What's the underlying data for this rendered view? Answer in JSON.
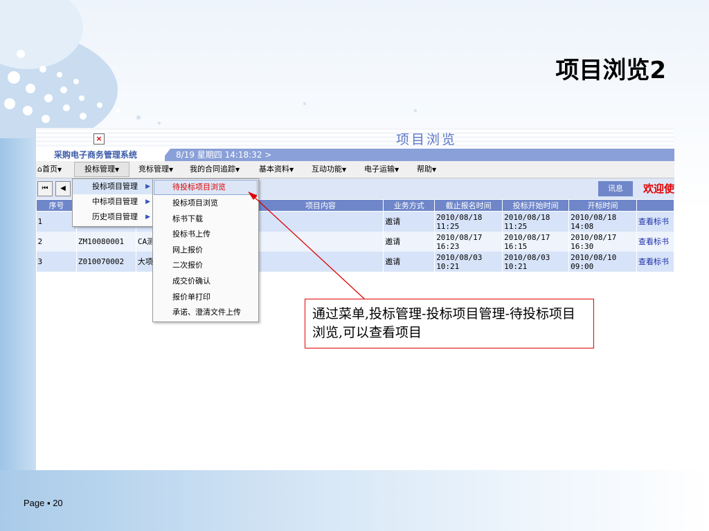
{
  "slide": {
    "title": "项目浏览2",
    "page_label": "Page ▪ 20"
  },
  "app": {
    "title": "项目浏览",
    "close_symbol": "×",
    "system_name": "采购电子商务管理系统",
    "datetime": "8/19 星期四  14:18:32 >",
    "news_label": "讯息",
    "welcome_text": "欢迎使"
  },
  "menu": [
    {
      "label": "首页",
      "icon": "home-icon"
    },
    {
      "label": "投标管理"
    },
    {
      "label": "竞标管理"
    },
    {
      "label": "我的合同追踪"
    },
    {
      "label": "基本资料"
    },
    {
      "label": "互动功能"
    },
    {
      "label": "电子运输"
    },
    {
      "label": "帮助"
    }
  ],
  "submenu": [
    {
      "label": "投标项目管理"
    },
    {
      "label": "中标项目管理"
    },
    {
      "label": "历史项目管理"
    }
  ],
  "submenu2": [
    {
      "label": "待投标项目浏览"
    },
    {
      "label": "投标项目浏览"
    },
    {
      "label": "标书下载"
    },
    {
      "label": "投标书上传"
    },
    {
      "label": "网上报价"
    },
    {
      "label": "二次报价"
    },
    {
      "label": "成交价确认"
    },
    {
      "label": "报价单打印"
    },
    {
      "label": "承诺、澄清文件上传"
    }
  ],
  "table": {
    "headers": [
      "序号",
      "",
      "",
      "项目内容",
      "业务方式",
      "截止报名时间",
      "投标开始时间",
      "开标时间",
      ""
    ],
    "rows": [
      {
        "no": "1",
        "code": "",
        "name": "",
        "mode": "邀请",
        "deadline": "2010/08/18 11:25",
        "start": "2010/08/18 11:25",
        "open": "2010/08/18 14:08",
        "action": "查看标书"
      },
      {
        "no": "2",
        "code": "ZM10080001",
        "name": "CA测",
        "mode": "邀请",
        "deadline": "2010/08/17 16:23",
        "start": "2010/08/17 16:15",
        "open": "2010/08/17 16:30",
        "action": "查看标书"
      },
      {
        "no": "3",
        "code": "Z010070002",
        "name": "大项",
        "mode": "邀请",
        "deadline": "2010/08/03 10:21",
        "start": "2010/08/03 10:21",
        "open": "2010/08/10 09:00",
        "action": "查看标书"
      }
    ]
  },
  "annotation": "通过菜单,投标管理-投标项目管理-待投标项目浏览,可以查看项目",
  "colors": {
    "accent": "#6f86c9",
    "callout": "#e00000"
  }
}
